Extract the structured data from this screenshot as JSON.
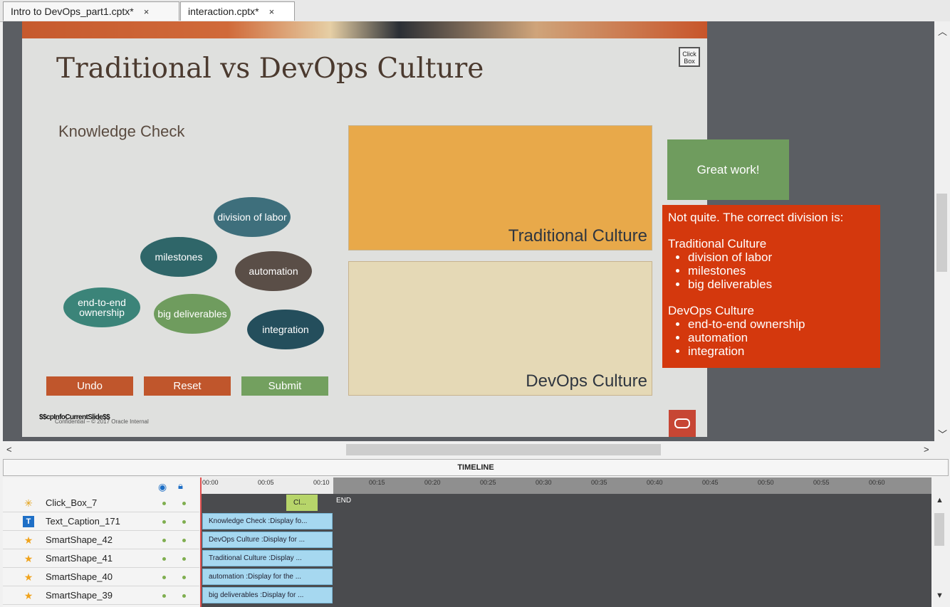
{
  "tabs": [
    {
      "label": "Intro to DevOps_part1.cptx*",
      "close": "×"
    },
    {
      "label": "interaction.cptx*",
      "close": "×"
    }
  ],
  "slide": {
    "title": "Traditional vs DevOps Culture",
    "clickbox_label": "Click Box",
    "subtitle": "Knowledge Check",
    "drag_items": [
      "division of labor",
      "milestones",
      "automation",
      "end-to-end ownership",
      "big deliverables",
      "integration"
    ],
    "buttons": {
      "undo": "Undo",
      "reset": "Reset",
      "submit": "Submit"
    },
    "drop_targets": {
      "traditional": "Traditional Culture",
      "devops": "DevOps Culture"
    },
    "footer_variable": "$$cpInfoCurrentSlide$$",
    "footer_confidential": "Confidential – © 2017 Oracle Internal",
    "colors": {
      "traditional_fill": "#e8a94a",
      "devops_fill": "#e5d9b6",
      "correct": "#6f9c5e",
      "incorrect": "#d4380d"
    }
  },
  "feedback": {
    "correct": "Great work!",
    "incorrect_intro": "Not quite. The correct division is:",
    "trad_heading": "Traditional Culture",
    "trad_items": [
      "division of labor",
      "milestones",
      "big deliverables"
    ],
    "devops_heading": "DevOps Culture",
    "devops_items": [
      "end-to-end ownership",
      "automation",
      "integration"
    ]
  },
  "timeline": {
    "header": "TIMELINE",
    "ticks": [
      "00:00",
      "00:05",
      "00:10",
      "00:15",
      "00:20",
      "00:25",
      "00:30",
      "00:35",
      "00:40",
      "00:45",
      "00:50",
      "00:55",
      "00:60"
    ],
    "end_label": "END",
    "clickbox_bar": "Cl...",
    "rows": [
      {
        "name": "Click_Box_7",
        "icon": "click-box-icon",
        "bar": ""
      },
      {
        "name": "Text_Caption_171",
        "icon": "text-caption-icon",
        "bar": "Knowledge Check :Display fo..."
      },
      {
        "name": "SmartShape_42",
        "icon": "star-icon",
        "bar": "DevOps Culture :Display for ..."
      },
      {
        "name": "SmartShape_41",
        "icon": "star-icon",
        "bar": "Traditional Culture  :Display ..."
      },
      {
        "name": "SmartShape_40",
        "icon": "star-icon",
        "bar": "automation :Display for the ..."
      },
      {
        "name": "SmartShape_39",
        "icon": "star-icon",
        "bar": "big deliverables :Display for ..."
      }
    ]
  }
}
